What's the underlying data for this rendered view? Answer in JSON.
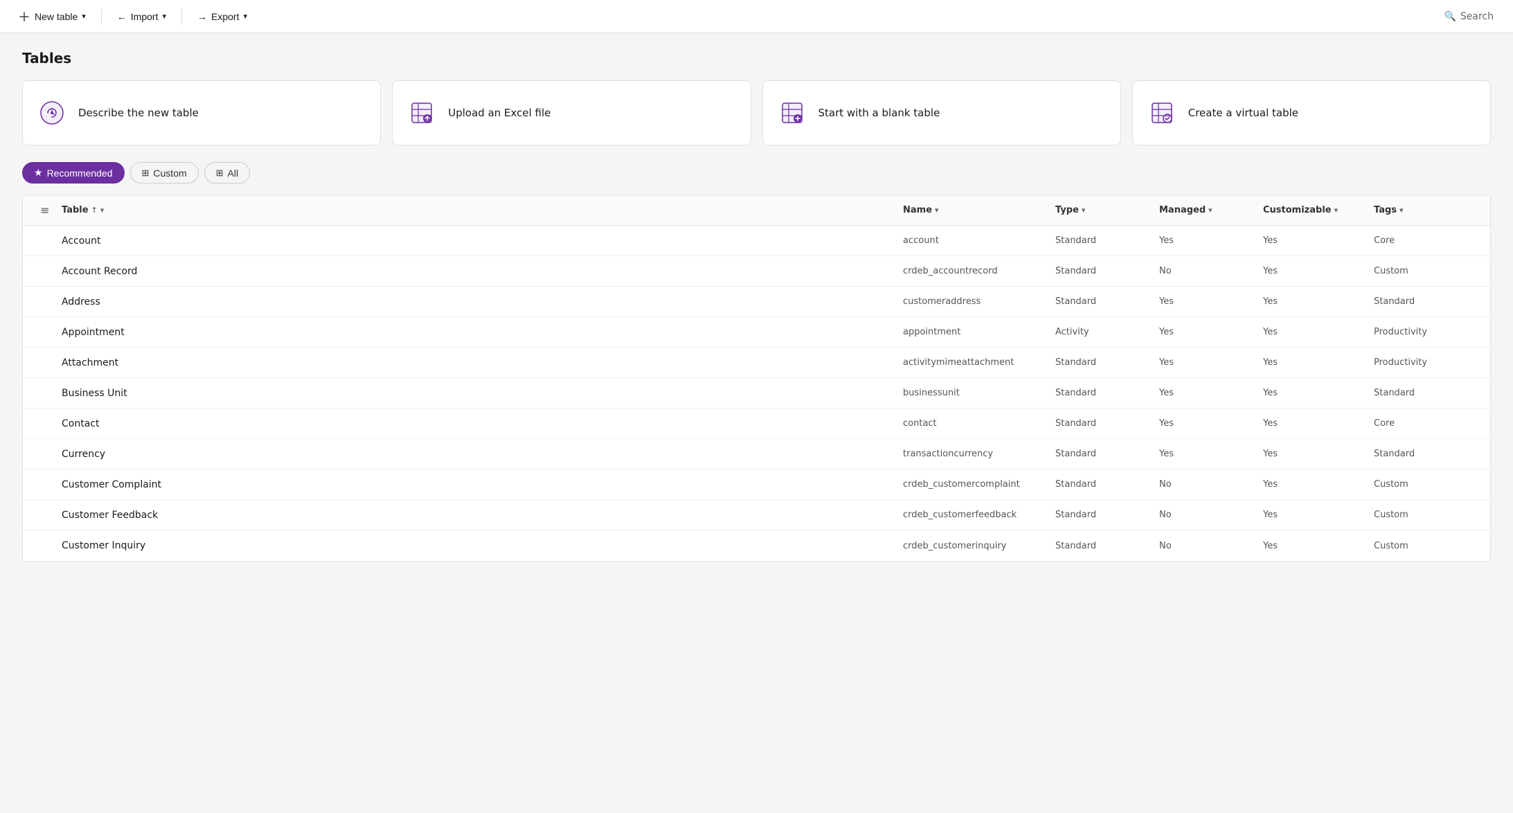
{
  "toolbar": {
    "new_table_label": "New table",
    "import_label": "Import",
    "export_label": "Export",
    "search_label": "Search"
  },
  "page": {
    "title": "Tables"
  },
  "action_cards": [
    {
      "id": "describe",
      "label": "Describe the new table",
      "icon": "ai"
    },
    {
      "id": "upload",
      "label": "Upload an Excel file",
      "icon": "excel"
    },
    {
      "id": "blank",
      "label": "Start with a blank table",
      "icon": "blank"
    },
    {
      "id": "virtual",
      "label": "Create a virtual table",
      "icon": "virtual"
    }
  ],
  "filters": [
    {
      "id": "recommended",
      "label": "Recommended",
      "active": true
    },
    {
      "id": "custom",
      "label": "Custom",
      "active": false
    },
    {
      "id": "all",
      "label": "All",
      "active": false
    }
  ],
  "table": {
    "columns": [
      {
        "id": "table",
        "label": "Table",
        "sortable": true,
        "sort": "asc"
      },
      {
        "id": "name",
        "label": "Name",
        "sortable": true
      },
      {
        "id": "type",
        "label": "Type",
        "sortable": true
      },
      {
        "id": "managed",
        "label": "Managed",
        "sortable": true
      },
      {
        "id": "customizable",
        "label": "Customizable",
        "sortable": true
      },
      {
        "id": "tags",
        "label": "Tags",
        "sortable": true
      }
    ],
    "rows": [
      {
        "table": "Account",
        "name": "account",
        "type": "Standard",
        "managed": "Yes",
        "customizable": "Yes",
        "tags": "Core"
      },
      {
        "table": "Account Record",
        "name": "crdeb_accountrecord",
        "type": "Standard",
        "managed": "No",
        "customizable": "Yes",
        "tags": "Custom"
      },
      {
        "table": "Address",
        "name": "customeraddress",
        "type": "Standard",
        "managed": "Yes",
        "customizable": "Yes",
        "tags": "Standard"
      },
      {
        "table": "Appointment",
        "name": "appointment",
        "type": "Activity",
        "managed": "Yes",
        "customizable": "Yes",
        "tags": "Productivity"
      },
      {
        "table": "Attachment",
        "name": "activitymimeattachment",
        "type": "Standard",
        "managed": "Yes",
        "customizable": "Yes",
        "tags": "Productivity"
      },
      {
        "table": "Business Unit",
        "name": "businessunit",
        "type": "Standard",
        "managed": "Yes",
        "customizable": "Yes",
        "tags": "Standard"
      },
      {
        "table": "Contact",
        "name": "contact",
        "type": "Standard",
        "managed": "Yes",
        "customizable": "Yes",
        "tags": "Core"
      },
      {
        "table": "Currency",
        "name": "transactioncurrency",
        "type": "Standard",
        "managed": "Yes",
        "customizable": "Yes",
        "tags": "Standard"
      },
      {
        "table": "Customer Complaint",
        "name": "crdeb_customercomplaint",
        "type": "Standard",
        "managed": "No",
        "customizable": "Yes",
        "tags": "Custom"
      },
      {
        "table": "Customer Feedback",
        "name": "crdeb_customerfeedback",
        "type": "Standard",
        "managed": "No",
        "customizable": "Yes",
        "tags": "Custom"
      },
      {
        "table": "Customer Inquiry",
        "name": "crdeb_customerinquiry",
        "type": "Standard",
        "managed": "No",
        "customizable": "Yes",
        "tags": "Custom"
      }
    ]
  },
  "colors": {
    "accent": "#6b2fa0",
    "accent_light": "#f3eefa"
  }
}
